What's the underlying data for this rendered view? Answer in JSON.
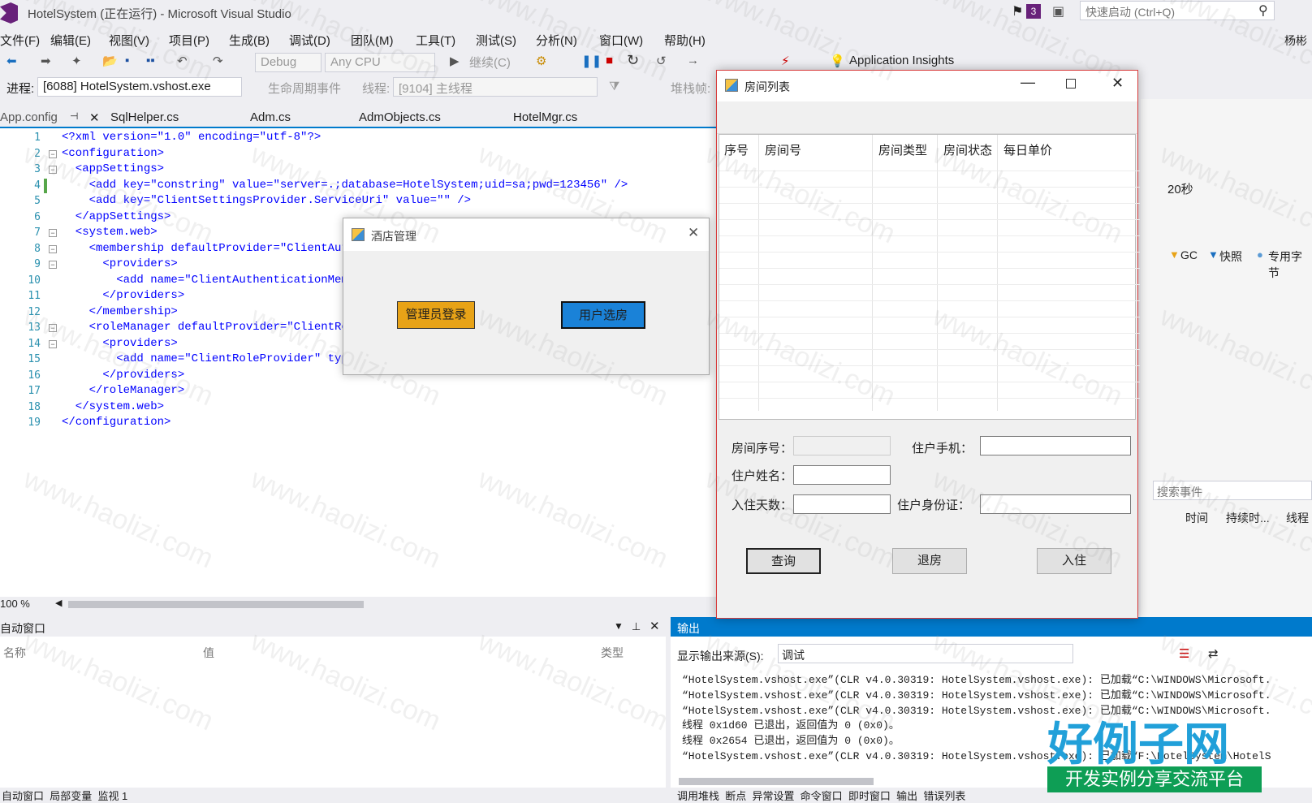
{
  "title": "HotelSystem (正在运行) - Microsoft Visual Studio",
  "notif_count": "3",
  "quick_launch": "快速启动 (Ctrl+Q)",
  "corner_user": "杨彬",
  "menu": [
    "文件(F)",
    "编辑(E)",
    "视图(V)",
    "项目(P)",
    "生成(B)",
    "调试(D)",
    "团队(M)",
    "工具(T)",
    "测试(S)",
    "分析(N)",
    "窗口(W)",
    "帮助(H)"
  ],
  "toolbar": {
    "config": "Debug",
    "platform": "Any CPU",
    "continue": "继续(C)",
    "insights": "Application Insights"
  },
  "toolbar2": {
    "process_label": "进程:",
    "process": "[6088] HotelSystem.vshost.exe",
    "lifecycle": "生命周期事件",
    "thread_label": "线程:",
    "thread": "[9104] 主线程",
    "stack": "堆栈帧:"
  },
  "tabs": [
    "App.config",
    "SqlHelper.cs",
    "Adm.cs",
    "AdmObjects.cs",
    "HotelMgr.cs"
  ],
  "code": [
    "<?xml version=\"1.0\" encoding=\"utf-8\"?>",
    "<configuration>",
    "  <appSettings>",
    "    <add key=\"constring\" value=\"server=.;database=HotelSystem;uid=sa;pwd=123456\" />",
    "    <add key=\"ClientSettingsProvider.ServiceUri\" value=\"\" />",
    "  </appSettings>",
    "  <system.web>",
    "    <membership defaultProvider=\"ClientAuthe",
    "      <providers>",
    "        <add name=\"ClientAuthenticationMembe",
    "      </providers>",
    "    </membership>",
    "    <roleManager defaultProvider=\"ClientRole",
    "      <providers>",
    "        <add name=\"ClientRoleProvider\" type=",
    "      </providers>",
    "    </roleManager>",
    "  </system.web>",
    "</configuration>"
  ],
  "line_numbers": [
    "1",
    "2",
    "3",
    "4",
    "5",
    "6",
    "7",
    "8",
    "9",
    "10",
    "11",
    "12",
    "13",
    "14",
    "15",
    "16",
    "17",
    "18",
    "19"
  ],
  "zoom": "100 %",
  "diag": {
    "seconds": "20秒",
    "gc": "GC",
    "snapshot": "快照",
    "bytes": "专用字节",
    "search": "搜索事件",
    "col_time": "时间",
    "col_duration": "持续时...",
    "col_thread": "线程"
  },
  "bottom_left": {
    "title": "自动窗口",
    "col_name": "名称",
    "col_value": "值",
    "col_type": "类型",
    "tabs": "自动窗口  局部变量  监视 1"
  },
  "output": {
    "title": "输出",
    "source_label": "显示输出来源(S):",
    "source": "调试",
    "lines": [
      "“HotelSystem.vshost.exe”(CLR v4.0.30319: HotelSystem.vshost.exe): 已加载“C:\\WINDOWS\\Microsoft.",
      "“HotelSystem.vshost.exe”(CLR v4.0.30319: HotelSystem.vshost.exe): 已加载“C:\\WINDOWS\\Microsoft.",
      "“HotelSystem.vshost.exe”(CLR v4.0.30319: HotelSystem.vshost.exe): 已加载“C:\\WINDOWS\\Microsoft.",
      "线程 0x1d60 已退出，返回值为 0 (0x0)。",
      "线程 0x2654 已退出，返回值为 0 (0x0)。",
      "“HotelSystem.vshost.exe”(CLR v4.0.30319: HotelSystem.vshost.exe): 已加载“F:\\HotelSystem\\HotelS"
    ],
    "tabs": "调用堆栈  断点  异常设置  命令窗口  即时窗口  输出  错误列表"
  },
  "hotel_win": {
    "title": "酒店管理",
    "admin_btn": "管理员登录",
    "user_btn": "用户选房",
    "admin_color": "#e8a317",
    "user_color": "#1a82d8"
  },
  "room_win": {
    "title": "房间列表",
    "headers": [
      "序号",
      "房间号",
      "房间类型",
      "房间状态",
      "每日单价"
    ],
    "lbl_room_no": "房间序号：",
    "lbl_phone": "住户手机：",
    "lbl_name": "住户姓名：",
    "lbl_days": "入住天数：",
    "lbl_id": "住户身份证：",
    "btn_query": "查询",
    "btn_checkout": "退房",
    "btn_checkin": "入住"
  },
  "watermark": "www.haolizi.com",
  "brand": "好例子网",
  "brand_sub": "开发实例分享交流平台"
}
